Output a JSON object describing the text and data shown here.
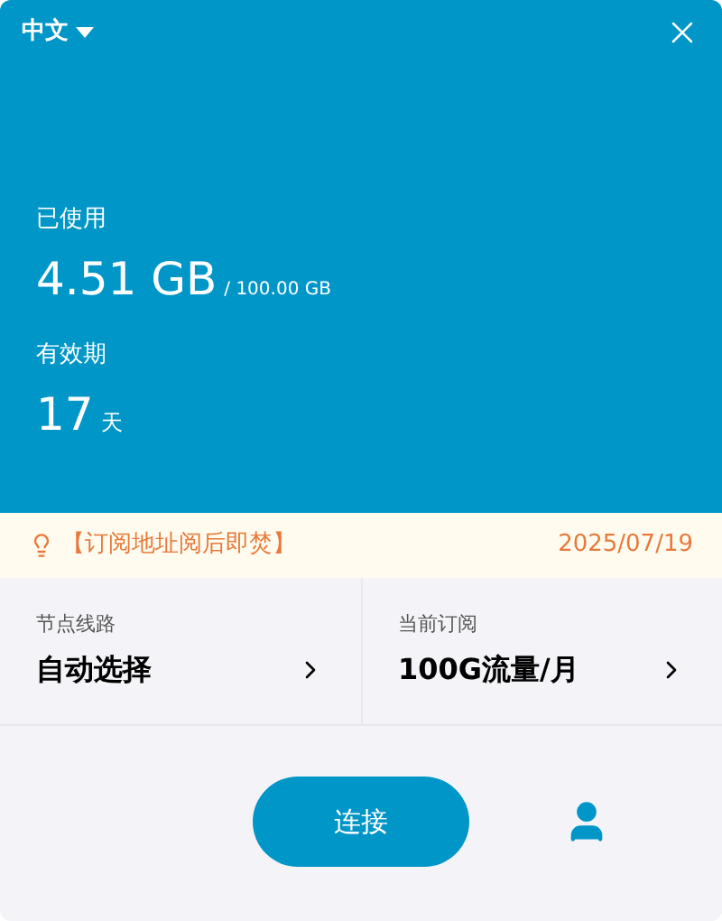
{
  "language": {
    "label": "中文"
  },
  "usage": {
    "label": "已使用",
    "value": "4.51 GB",
    "total": "/ 100.00 GB"
  },
  "validity": {
    "label": "有效期",
    "value": "17",
    "unit": "天"
  },
  "notice": {
    "text": "【订阅地址阅后即焚】",
    "date": "2025/07/19"
  },
  "cards": [
    {
      "label": "节点线路",
      "value": "自动选择"
    },
    {
      "label": "当前订阅",
      "value": "100G流量/月"
    }
  ],
  "connect_button": {
    "label": "连接"
  }
}
